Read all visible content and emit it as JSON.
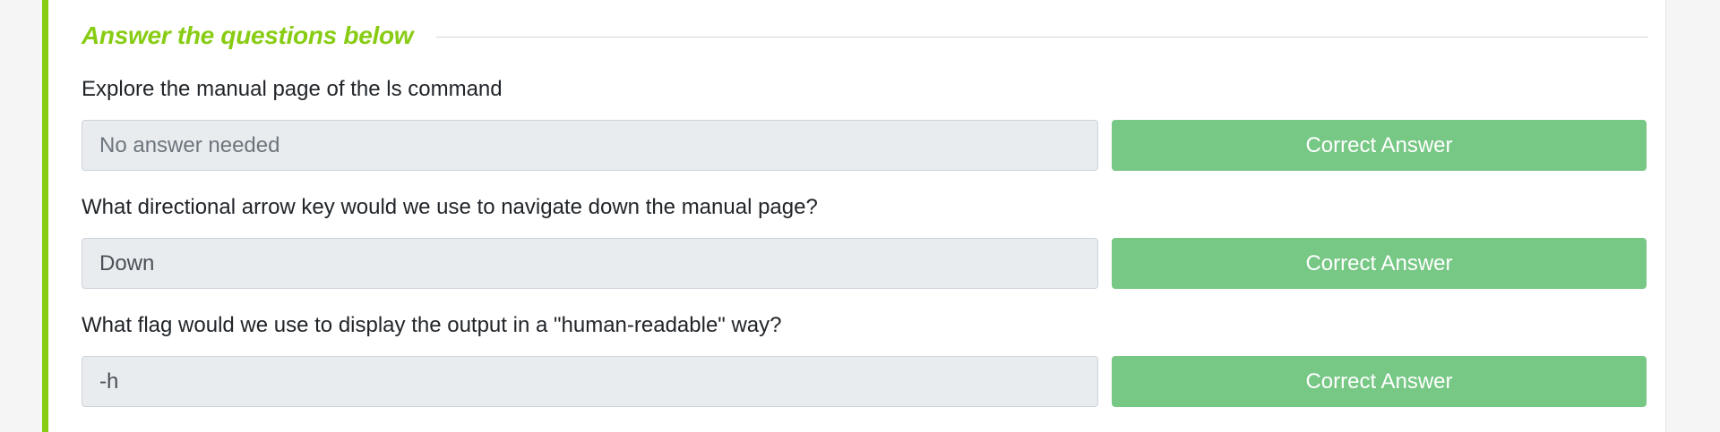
{
  "section": {
    "title": "Answer the questions below"
  },
  "questions": [
    {
      "text": "Explore the manual page of the ls command",
      "answer": "No answer needed",
      "button_label": "Correct Answer"
    },
    {
      "text": "What directional arrow key would we use to navigate down the manual page?",
      "answer": "Down",
      "button_label": "Correct Answer"
    },
    {
      "text": "What flag would we use to display the output in a \"human-readable\" way?",
      "answer": "-h",
      "button_label": "Correct Answer"
    }
  ],
  "colors": {
    "accent": "#88cc14",
    "correct_button": "#77c785",
    "answer_background": "#e9ecef"
  }
}
